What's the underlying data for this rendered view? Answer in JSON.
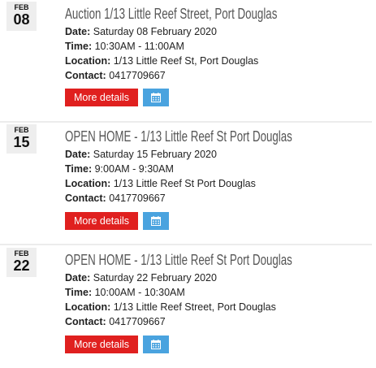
{
  "labels": {
    "date": "Date:",
    "time": "Time:",
    "location": "Location:",
    "contact": "Contact:",
    "more_details": "More details",
    "calendar_icon": "calendar-icon"
  },
  "events": [
    {
      "month": "FEB",
      "day": "08",
      "title": "Auction 1/13 Little Reef Street, Port Douglas",
      "date": "Saturday 08 February 2020",
      "time": "10:30AM - 11:00AM",
      "location": "1/13 Little Reef St, Port Douglas",
      "contact": "0417709667"
    },
    {
      "month": "FEB",
      "day": "15",
      "title": "OPEN HOME - 1/13 Little Reef St Port Douglas",
      "date": "Saturday 15 February 2020",
      "time": "9:00AM - 9:30AM",
      "location": "1/13 Little Reef St Port Douglas",
      "contact": "0417709667"
    },
    {
      "month": "FEB",
      "day": "22",
      "title": "OPEN HOME - 1/13 Little Reef St Port Douglas",
      "date": "Saturday 22 February 2020",
      "time": "10:00AM - 10:30AM",
      "location": "1/13 Little Reef Street, Port Douglas",
      "contact": "0417709667"
    }
  ],
  "colors": {
    "more_button": "#e0201f",
    "calendar_button": "#4aa3df",
    "title": "#565656"
  }
}
